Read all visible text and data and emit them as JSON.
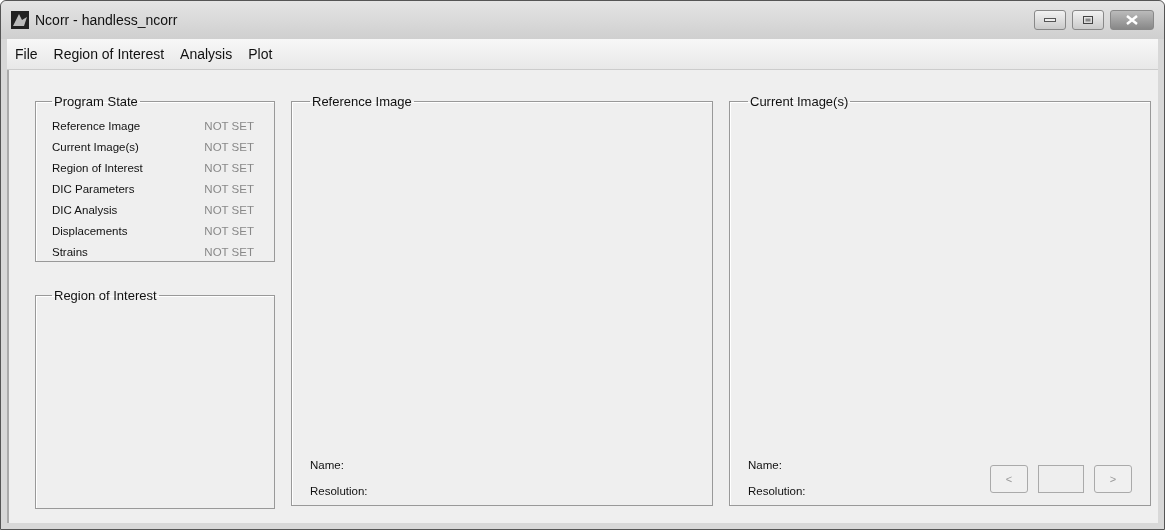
{
  "window": {
    "title": "Ncorr - handless_ncorr"
  },
  "menu": [
    "File",
    "Region of Interest",
    "Analysis",
    "Plot"
  ],
  "program_state": {
    "title": "Program State",
    "items": [
      {
        "label": "Reference Image",
        "status": "NOT SET"
      },
      {
        "label": "Current Image(s)",
        "status": "NOT SET"
      },
      {
        "label": "Region of Interest",
        "status": "NOT SET"
      },
      {
        "label": "DIC Parameters",
        "status": "NOT SET"
      },
      {
        "label": "DIC Analysis",
        "status": "NOT SET"
      },
      {
        "label": "Displacements",
        "status": "NOT SET"
      },
      {
        "label": "Strains",
        "status": "NOT SET"
      }
    ]
  },
  "roi_panel": {
    "title": "Region of Interest"
  },
  "reference_panel": {
    "title": "Reference Image",
    "name_label": "Name:",
    "resolution_label": "Resolution:"
  },
  "current_panel": {
    "title": "Current Image(s)",
    "name_label": "Name:",
    "resolution_label": "Resolution:",
    "nav": {
      "prev": {
        "label": "<",
        "disabled": true
      },
      "next": {
        "label": ">",
        "disabled": true
      }
    }
  }
}
